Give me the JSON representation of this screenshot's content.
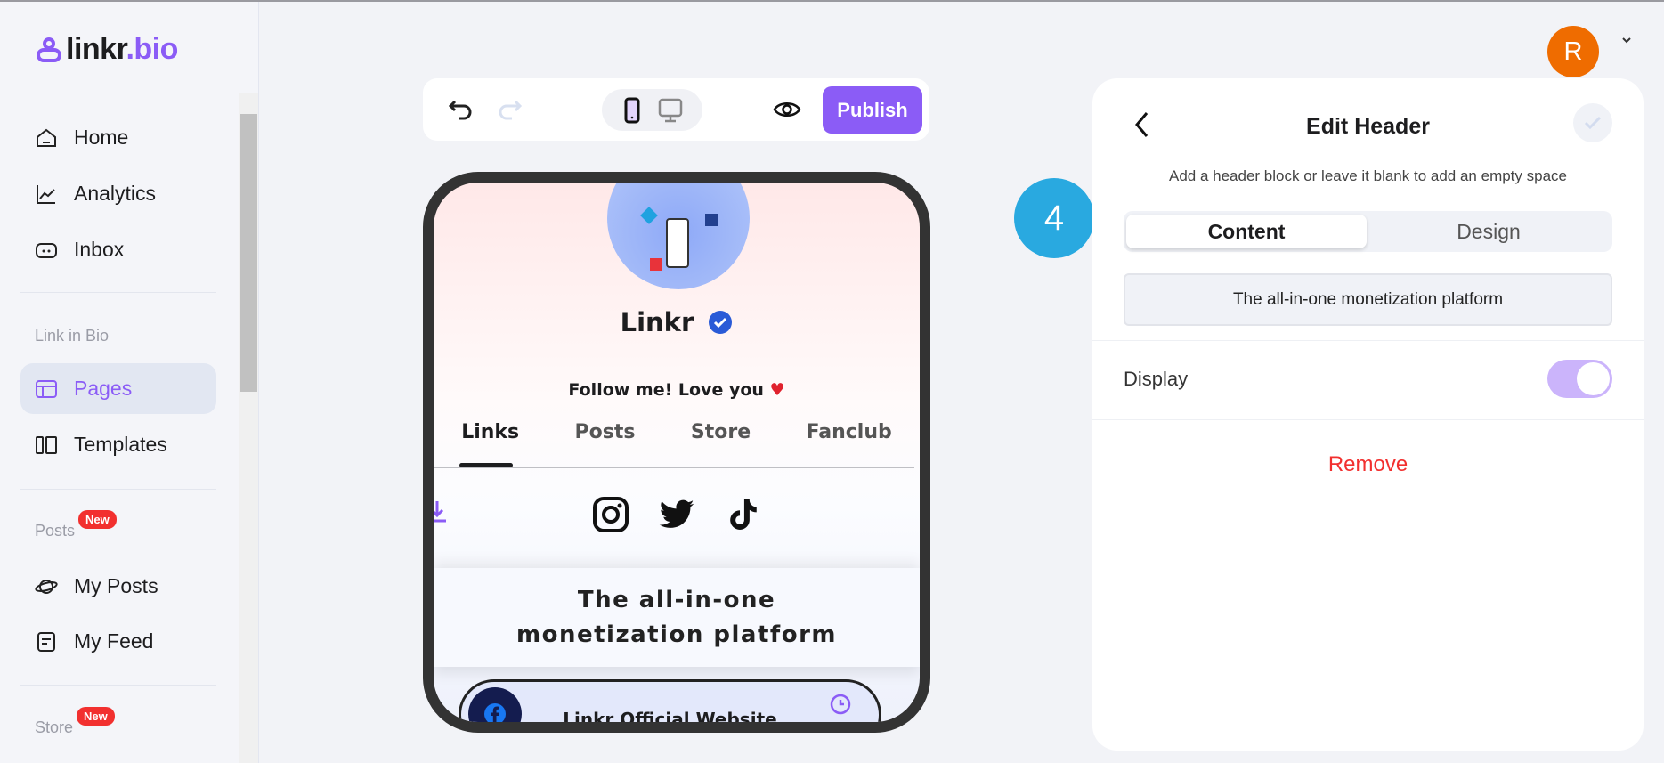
{
  "brand": {
    "name_a": "linkr",
    "name_b": ".bio",
    "accent": "#8b5cf6"
  },
  "sidebar": {
    "items": [
      {
        "label": "Home",
        "icon": "home-icon"
      },
      {
        "label": "Analytics",
        "icon": "chart-line-icon"
      },
      {
        "label": "Inbox",
        "icon": "inbox-icon"
      }
    ],
    "link_in_bio": {
      "title": "Link in Bio",
      "items": [
        {
          "label": "Pages",
          "icon": "layout-icon",
          "active": true
        },
        {
          "label": "Templates",
          "icon": "columns-icon"
        }
      ]
    },
    "posts": {
      "title": "Posts",
      "badge": "New",
      "items": [
        {
          "label": "My Posts",
          "icon": "planet-icon"
        },
        {
          "label": "My Feed",
          "icon": "feed-icon"
        }
      ]
    },
    "store": {
      "title": "Store",
      "badge": "New"
    }
  },
  "toolbar": {
    "publish_label": "Publish",
    "device": "mobile"
  },
  "preview": {
    "name": "Linkr",
    "bio": "Follow me! Love you",
    "tabs": [
      "Links",
      "Posts",
      "Store",
      "Fanclub"
    ],
    "active_tab": "Links",
    "socials": [
      "instagram-icon",
      "twitter-icon",
      "tiktok-icon"
    ],
    "header_text": "The all-in-one monetization platform",
    "link_title": "Linkr Official Website"
  },
  "step_badge": "4",
  "user": {
    "initial": "R",
    "color": "#ef6c00"
  },
  "panel": {
    "title": "Edit Header",
    "subtitle": "Add a header block or leave it blank to add an empty space",
    "tabs": [
      "Content",
      "Design"
    ],
    "active_tab": "Content",
    "header_value": "The all-in-one monetization platform",
    "display_label": "Display",
    "display_on": true,
    "remove_label": "Remove"
  }
}
